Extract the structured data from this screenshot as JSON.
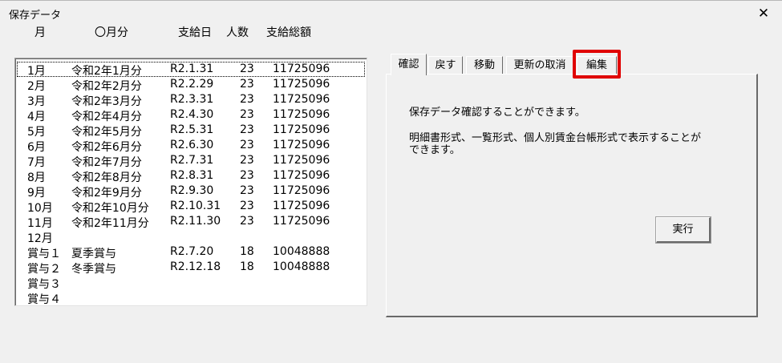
{
  "window": {
    "title": "保存データ",
    "close_symbol": "✕"
  },
  "columns": [
    "月",
    "〇月分",
    "支給日",
    "人数",
    "支給総額"
  ],
  "rows": [
    [
      "1月",
      "令和2年1月分",
      "R2.1.31",
      "23",
      "11725096"
    ],
    [
      "2月",
      "令和2年2月分",
      "R2.2.29",
      "23",
      "11725096"
    ],
    [
      "3月",
      "令和2年3月分",
      "R2.3.31",
      "23",
      "11725096"
    ],
    [
      "4月",
      "令和2年4月分",
      "R2.4.30",
      "23",
      "11725096"
    ],
    [
      "5月",
      "令和2年5月分",
      "R2.5.31",
      "23",
      "11725096"
    ],
    [
      "6月",
      "令和2年6月分",
      "R2.6.30",
      "23",
      "11725096"
    ],
    [
      "7月",
      "令和2年7月分",
      "R2.7.31",
      "23",
      "11725096"
    ],
    [
      "8月",
      "令和2年8月分",
      "R2.8.31",
      "23",
      "11725096"
    ],
    [
      "9月",
      "令和2年9月分",
      "R2.9.30",
      "23",
      "11725096"
    ],
    [
      "10月",
      "令和2年10月分",
      "R2.10.31",
      "23",
      "11725096"
    ],
    [
      "11月",
      "令和2年11月分",
      "R2.11.30",
      "23",
      "11725096"
    ],
    [
      "12月",
      "",
      "",
      "",
      ""
    ],
    [
      "賞与１",
      "夏季賞与",
      "R2.7.20",
      "18",
      "10048888"
    ],
    [
      "賞与２",
      "冬季賞与",
      "R2.12.18",
      "18",
      "10048888"
    ],
    [
      "賞与３",
      "",
      "",
      "",
      ""
    ],
    [
      "賞与４",
      "",
      "",
      "",
      ""
    ]
  ],
  "tabs": [
    "確認",
    "戻す",
    "移動",
    "更新の取消",
    "編集"
  ],
  "active_tab": 0,
  "highlighted_tab": 4,
  "panel": {
    "description_1": "保存データ確認することができます。",
    "description_2": "明細書形式、一覧形式、個人別賃金台帳形式で表示することができます。",
    "execute_label": "実行"
  },
  "colors": {
    "highlight": "#e00000",
    "background": "#f0f0f0"
  }
}
